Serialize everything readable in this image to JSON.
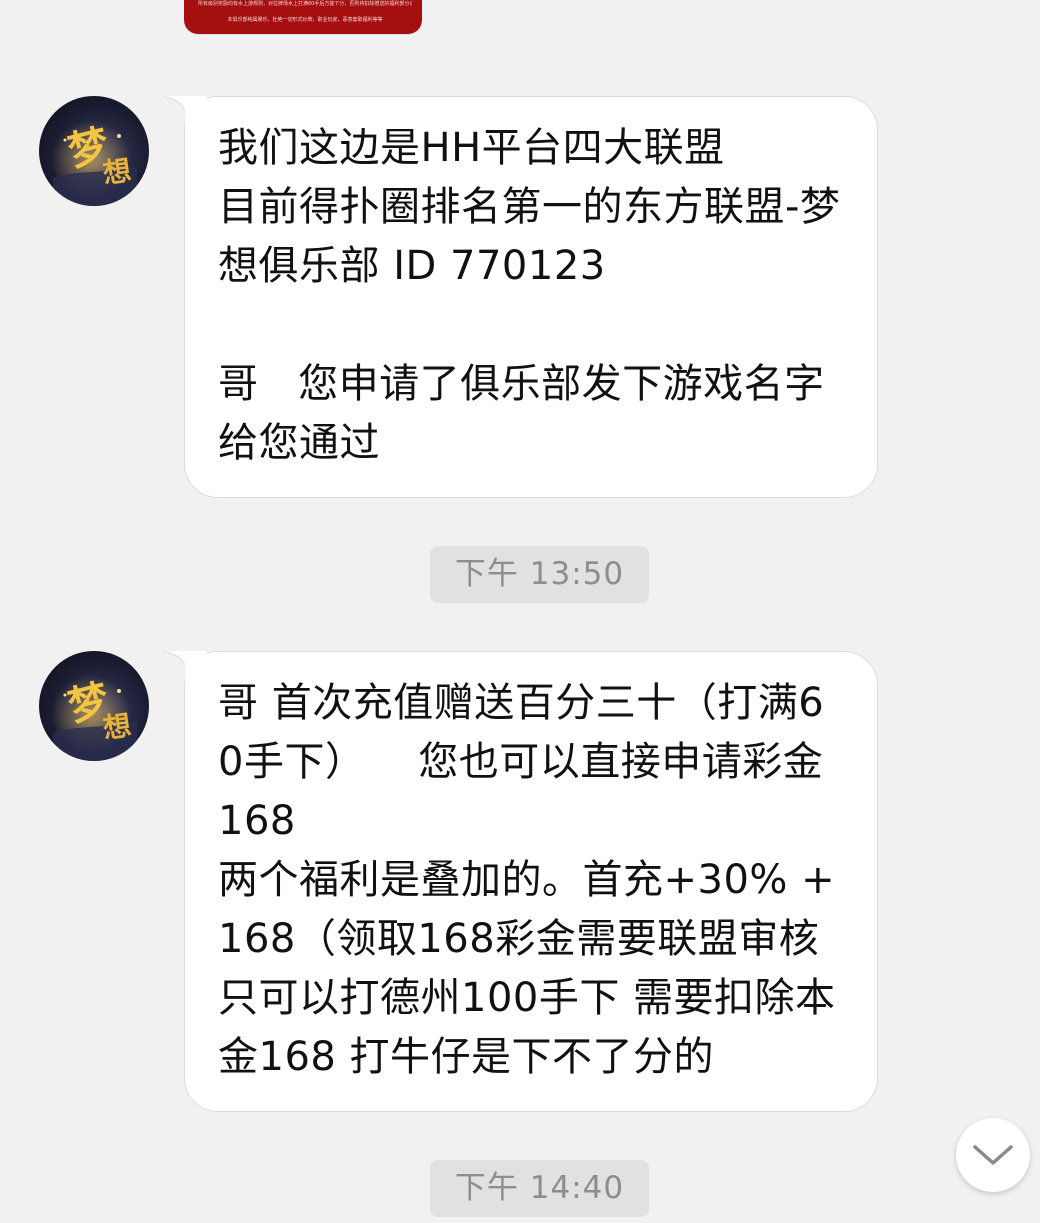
{
  "top_image": {
    "line1": "所有级别奖励均有水上游规则，对拉牌场水上打满60手后方能下分，否则将扣除赠送的福利部分以及盈利部分的30%",
    "line2": "本俱乐部纯属娱乐，杜绝一切形式炒牌，职业玩家，恶意套取福利等等"
  },
  "messages": [
    {
      "avatar_icon": "dream-club-avatar",
      "text": "我们这边是HH平台四大联盟\n目前得扑圈排名第一的东方联盟-梦想俱乐部 ID 770123\n\n哥   您申请了俱乐部发下游戏名字给您通过"
    },
    {
      "time": "下午 13:50"
    },
    {
      "avatar_icon": "dream-club-avatar",
      "text": "哥 首次充值赠送百分三十（打满60手下）    您也可以直接申请彩金168\n两个福利是叠加的。首充+30% +168（领取168彩金需要联盟审核只可以打德州100手下 需要扣除本金168 打牛仔是下不了分的"
    },
    {
      "time": "下午 14:40"
    }
  ],
  "scroll_button": {
    "icon": "chevron-down-icon"
  },
  "colors": {
    "background": "#f1f1f1",
    "bubble": "#ffffff",
    "time_chip": "#e1e1e1",
    "time_text": "#8d8d8d",
    "image_card": "#a50f0f"
  }
}
